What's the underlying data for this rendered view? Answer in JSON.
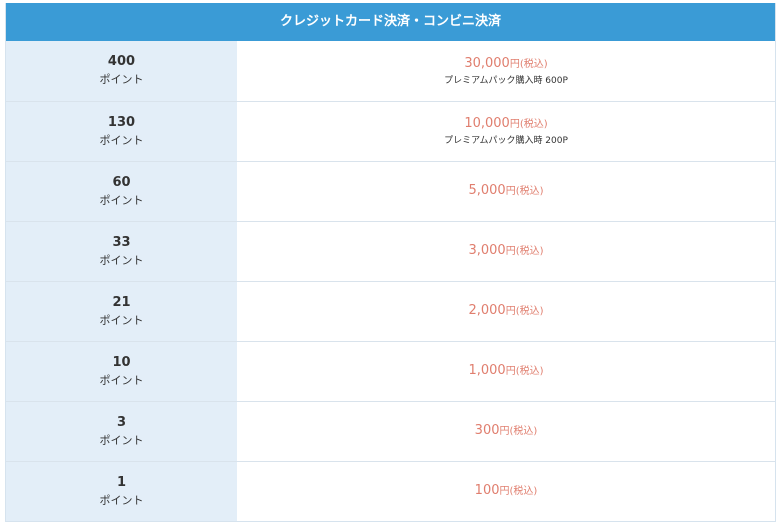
{
  "header": {
    "title": "クレジットカード決済・コンビニ決済"
  },
  "rows": [
    {
      "points": "400",
      "unit": "ポイント",
      "price": "30,000",
      "yen": "円",
      "tax": "(税込)",
      "note": "プレミアムパック購入時 600P"
    },
    {
      "points": "130",
      "unit": "ポイント",
      "price": "10,000",
      "yen": "円",
      "tax": "(税込)",
      "note": "プレミアムパック購入時 200P"
    },
    {
      "points": "60",
      "unit": "ポイント",
      "price": "5,000",
      "yen": "円",
      "tax": "(税込)",
      "note": ""
    },
    {
      "points": "33",
      "unit": "ポイント",
      "price": "3,000",
      "yen": "円",
      "tax": "(税込)",
      "note": ""
    },
    {
      "points": "21",
      "unit": "ポイント",
      "price": "2,000",
      "yen": "円",
      "tax": "(税込)",
      "note": ""
    },
    {
      "points": "10",
      "unit": "ポイント",
      "price": "1,000",
      "yen": "円",
      "tax": "(税込)",
      "note": ""
    },
    {
      "points": "3",
      "unit": "ポイント",
      "price": "300",
      "yen": "円",
      "tax": "(税込)",
      "note": ""
    },
    {
      "points": "1",
      "unit": "ポイント",
      "price": "100",
      "yen": "円",
      "tax": "(税込)",
      "note": ""
    }
  ]
}
